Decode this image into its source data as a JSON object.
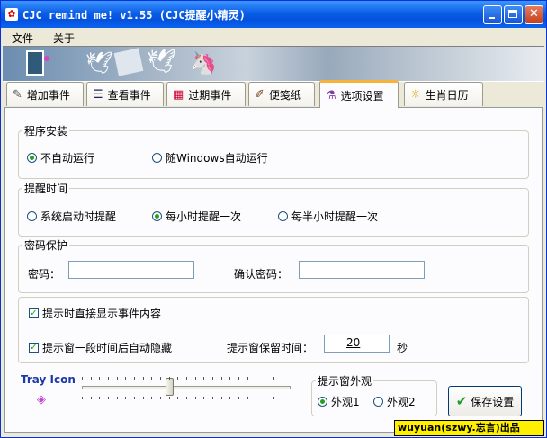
{
  "window": {
    "title": "CJC remind me! v1.55 (CJC提醒小精灵)"
  },
  "menu": {
    "items": [
      "文件",
      "关于"
    ]
  },
  "tabs": [
    {
      "label": "增加事件",
      "icon": "pencil-icon"
    },
    {
      "label": "查看事件",
      "icon": "list-icon"
    },
    {
      "label": "过期事件",
      "icon": "calendar-icon"
    },
    {
      "label": "便笺纸",
      "icon": "note-icon"
    },
    {
      "label": "选项设置",
      "icon": "settings-icon",
      "active": true
    },
    {
      "label": "生肖日历",
      "icon": "sun-icon"
    }
  ],
  "install": {
    "legend": "程序安装",
    "options": [
      {
        "label": "不自动运行",
        "selected": true
      },
      {
        "label": "随Windows自动运行",
        "selected": false
      }
    ]
  },
  "remind_time": {
    "legend": "提醒时间",
    "options": [
      {
        "label": "系统启动时提醒",
        "selected": false
      },
      {
        "label": "每小时提醒一次",
        "selected": true
      },
      {
        "label": "每半小时提醒一次",
        "selected": false
      }
    ]
  },
  "password": {
    "legend": "密码保护",
    "password_label": "密码：",
    "confirm_label": "确认密码：",
    "password_value": "",
    "confirm_value": ""
  },
  "display": {
    "show_content": {
      "label": "提示时直接显示事件内容",
      "checked": true
    },
    "auto_hide": {
      "label": "提示窗一段时间后自动隐藏",
      "checked": true
    },
    "keep_time_label": "提示窗保留时间：",
    "keep_time_value": "20",
    "keep_time_unit": "秒"
  },
  "tray": {
    "label": "Tray Icon",
    "slider_value": 0.42
  },
  "appearance": {
    "legend": "提示窗外观",
    "options": [
      {
        "label": "外观1",
        "selected": true
      },
      {
        "label": "外观2",
        "selected": false
      }
    ]
  },
  "save_button": {
    "label": "保存设置"
  },
  "credit": "wuyuan(szwy.忘言)出品",
  "colors": {
    "titlebar": "#0a5fe6",
    "active_tab_accent": "#f7b338",
    "credit_bg": "#ffef00"
  }
}
